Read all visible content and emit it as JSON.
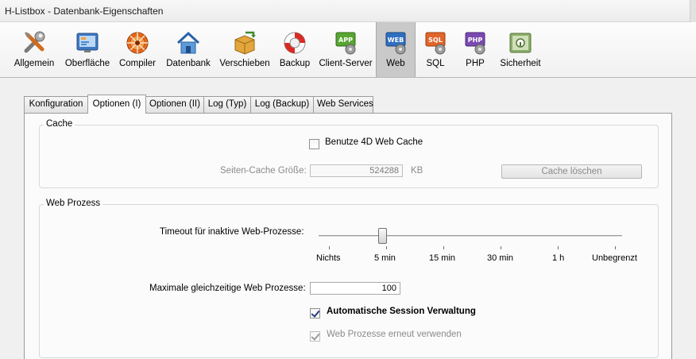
{
  "window": {
    "title": "H-Listbox - Datenbank-Eigenschaften"
  },
  "toolbar": {
    "items": [
      {
        "label": "Allgemein",
        "icon": "tools-icon"
      },
      {
        "label": "Oberfläche",
        "icon": "interface-icon"
      },
      {
        "label": "Compiler",
        "icon": "compiler-icon"
      },
      {
        "label": "Datenbank",
        "icon": "database-home-icon"
      },
      {
        "label": "Verschieben",
        "icon": "move-box-icon"
      },
      {
        "label": "Backup",
        "icon": "lifebuoy-icon"
      },
      {
        "label": "Client-Server",
        "icon": "app-gear-icon"
      },
      {
        "label": "Web",
        "icon": "web-gear-icon"
      },
      {
        "label": "SQL",
        "icon": "sql-gear-icon"
      },
      {
        "label": "PHP",
        "icon": "php-gear-icon"
      },
      {
        "label": "Sicherheit",
        "icon": "security-icon"
      }
    ],
    "active": "Web"
  },
  "tabs": {
    "items": [
      "Konfiguration",
      "Optionen (I)",
      "Optionen (II)",
      "Log (Typ)",
      "Log (Backup)",
      "Web Services"
    ],
    "active": "Optionen (I)"
  },
  "cache": {
    "title": "Cache",
    "use_cache_label": "Benutze 4D Web Cache",
    "use_cache_checked": false,
    "page_cache_label": "Seiten-Cache Größe:",
    "page_cache_value": "524288",
    "page_cache_unit": "KB",
    "clear_button_label": "Cache löschen"
  },
  "web_process": {
    "title": "Web Prozess",
    "timeout_label": "Timeout für inaktive Web-Prozesse:",
    "timeout_ticks": [
      "Nichts",
      "5 min",
      "15 min",
      "30 min",
      "1 h",
      "Unbegrenzt"
    ],
    "timeout_selected": "5 min",
    "max_processes_label": "Maximale gleichzeitige Web Prozesse:",
    "max_processes_value": "100",
    "auto_session_label": "Automatische Session Verwaltung",
    "auto_session_checked": true,
    "reuse_label": "Web Prozesse erneut verwenden",
    "reuse_checked": true
  }
}
